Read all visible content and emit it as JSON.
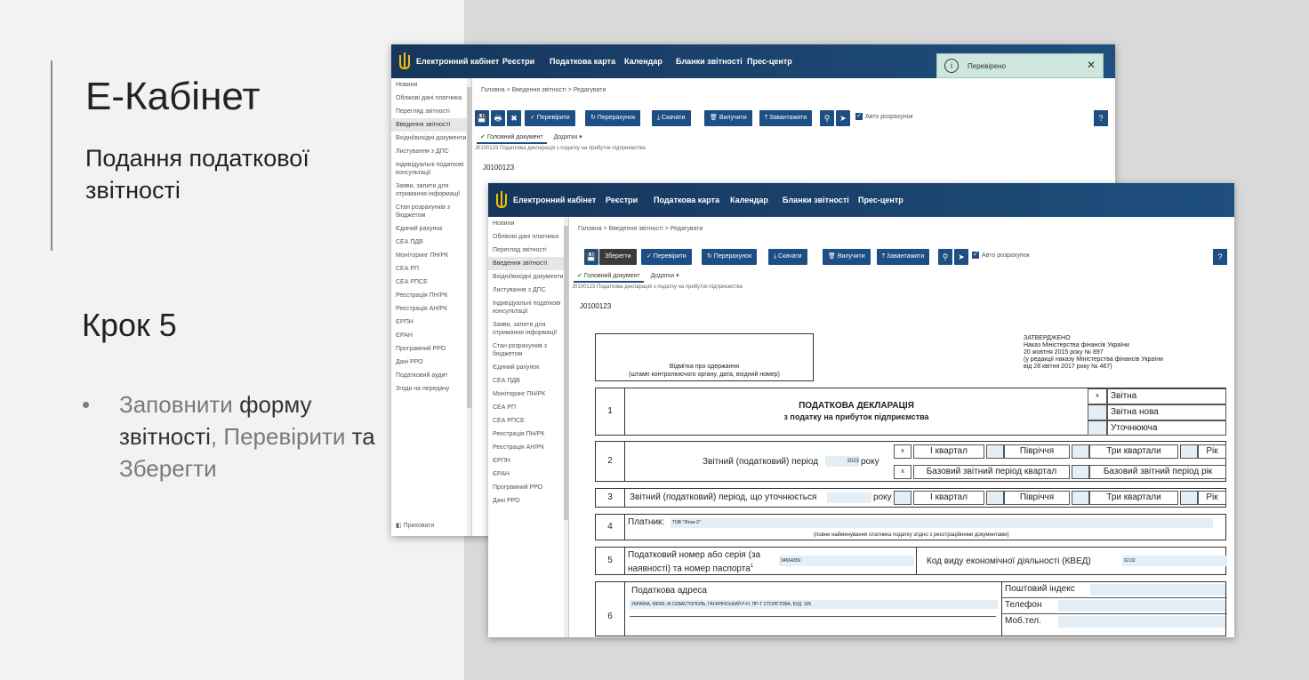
{
  "slide": {
    "title": "Е-Кабінет",
    "subtitle": "Подання податкової звітності",
    "step": "Крок 5",
    "bullet_parts": [
      "Заповнити ",
      "форму звітності",
      ", ",
      "Перевірити",
      " та ",
      "Зберегти"
    ]
  },
  "nav": {
    "brand": "Електронний кабінет",
    "items": [
      "Реєстри",
      "Податкова карта",
      "Календар",
      "Бланки звітності",
      "Прес-центр"
    ]
  },
  "sidebar_back": [
    "Новини",
    "Облікові дані платника",
    "Перегляд звітності",
    "Введення звітності",
    "Вхідні/вихідні документи",
    "Листування з ДПС",
    "Індивідуальні податкові консультації",
    "Заяви, запити для отримання інформації",
    "Стан розрахунків з бюджетом",
    "Єдиний рахунок",
    "СЕА ПДВ",
    "Моніторинг ПН/РК",
    "СЕА РП",
    "СЕА РПСЕ",
    "Реєстрація ПН/РК",
    "Реєстрація АН/РК",
    "ЄРПН",
    "ЄРАН",
    "Програмний РРО",
    "Дані РРО",
    "Податковий аудит",
    "Згоди на передачу"
  ],
  "sidebar_back_hide": "Приховати",
  "sidebar_front": [
    "Новини",
    "Облікові дані платника",
    "Перегляд звітності",
    "Введення звітності",
    "Вхідні/вихідні документи",
    "Листування з ДПС",
    "Індивідуальні податкові консультації",
    "Заяви, запити для отримання інформації",
    "Стан розрахунків з бюджетом",
    "Єдиний рахунок",
    "СЕА ПДВ",
    "Моніторинг ПН/РК",
    "СЕА РП",
    "СЕА РПСЕ",
    "Реєстрація ПН/РК",
    "Реєстрація АН/РК",
    "ЄРПН",
    "ЄРАН",
    "Програмний РРО",
    "Дані РРО"
  ],
  "active_item": "Введення звітності",
  "breadcrumb": "Головна  >  Введення звітності  >  Редагувати",
  "toolbar": {
    "save_icon": "💾",
    "print_icon": "🖶",
    "close_icon": "✖",
    "save": "Зберегти",
    "check": "✓ Перевірити",
    "recalc": "↻ Перерахунок",
    "download": "⤓ Скачати",
    "delete": "🗑 Вилучити",
    "upload": "⤒ Завантажити",
    "key_icon": "⚲",
    "send_icon": "➤",
    "auto": "Авто розрахунок",
    "help": "?"
  },
  "tabs": {
    "main": "Головний документ",
    "add": "Додатки ▾"
  },
  "doc_title": "J0100123 Податкова декларація з податку на прибуток підприємства",
  "doc_code": "J0100123",
  "toast": {
    "text": "Перевірено",
    "close": "✕"
  },
  "form": {
    "stamp_l1": "Відмітка про одержання",
    "stamp_l2": "(штамп контролюючого органу, дата, вхідний номер)",
    "approved": [
      "ЗАТВЕРДЖЕНО",
      "Наказ Міністерства фінансів України",
      "20 жовтня 2015 року № 897",
      "(у редакції наказу Міністерства фінансів України",
      "від 28 квітня 2017 року № 467)"
    ],
    "r1_num": "1",
    "r1_title": "ПОДАТКОВА ДЕКЛАРАЦІЯ",
    "r1_subtitle": "з податку на прибуток підприємства",
    "r1_x": "x",
    "r1_opts": [
      "Звітна",
      "Звітна нова",
      "Уточнююча"
    ],
    "r2_num": "2",
    "r2_label": "Звітний (податковий) період",
    "r2_year": "2023",
    "r2_year_suffix": "року",
    "r2_x1": "x",
    "r2_x2": "x",
    "r2_top": [
      "І квартал",
      "Півріччя",
      "Три квартали",
      "Рік"
    ],
    "r2_bottom": [
      "Базовий звітний період квартал",
      "Базовий звітний період рік"
    ],
    "r3_num": "3",
    "r3_label": "Звітний (податковий) період, що уточнюється",
    "r3_suffix": "року",
    "r3_opts": [
      "І квартал",
      "Півріччя",
      "Три квартали",
      "Рік"
    ],
    "r4_num": "4",
    "r4_label": "Платник:",
    "r4_value": "ТОВ \"Літан-3\"",
    "r4_note": "(повне найменування платника податку згідно з реєстраційними документами)",
    "r5_num": "5",
    "r5_label": "Податковий номер або серія (за наявності) та номер паспорта",
    "r5_sup": "1",
    "r5_value": "34564359",
    "r5_kved_label": "Код виду економічної діяльності (КВЕД)",
    "r5_kved": "62.02",
    "r6_num": "6",
    "r6_label": "Податкова адреса",
    "r6_value": "УКРАЇНА, 99000, М.СЕВАСТОПОЛЬ, ГАГАРІНСЬКИЙ Р-Н, ПР-Т СТОЛЄТОВА, БУД. 105",
    "r6_postal": "Поштовий індекс",
    "r6_phone": "Телефон",
    "r6_mobile": "Моб.тел."
  }
}
